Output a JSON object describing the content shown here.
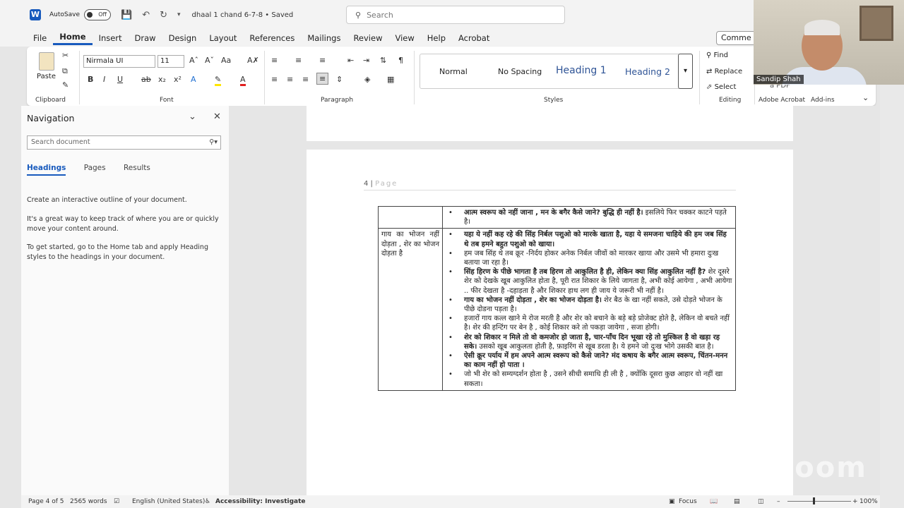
{
  "titlebar": {
    "autosave_label": "AutoSave",
    "autosave_state": "Off",
    "doc_name": "dhaal 1 chand 6-7-8 • Saved",
    "search_placeholder": "Search"
  },
  "menu": {
    "items": [
      "File",
      "Home",
      "Insert",
      "Draw",
      "Design",
      "Layout",
      "References",
      "Mailings",
      "Review",
      "View",
      "Help",
      "Acrobat"
    ],
    "comments": "Comme"
  },
  "ribbon": {
    "paste": "Paste",
    "font_name": "Nirmala UI",
    "font_size": "11",
    "groups": {
      "clipboard": "Clipboard",
      "font": "Font",
      "paragraph": "Paragraph",
      "styles": "Styles",
      "editing": "Editing",
      "adobe": "Adobe Acrobat",
      "addins": "Add-ins"
    },
    "styles": [
      "Normal",
      "No Spacing",
      "Heading 1",
      "Heading 2"
    ],
    "editing": {
      "find": "Find",
      "replace": "Replace",
      "select": "Select",
      "pdf": "a PDF"
    }
  },
  "navigation": {
    "title": "Navigation",
    "search_placeholder": "Search document",
    "tabs": [
      "Headings",
      "Pages",
      "Results"
    ],
    "p1": "Create an interactive outline of your document.",
    "p2": "It's a great way to keep track of where you are or quickly move your content around.",
    "p3": "To get started, go to the Home tab and apply Heading styles to the headings in your document."
  },
  "document": {
    "page_number": "4",
    "page_label": "Page",
    "row1": {
      "col1": "",
      "items": [
        {
          "bold": "आत्म स्वरूप को नहीं जाना , मन के बगैर कैसे जाने? बुद्धि ही नहीं है।",
          "normal": " इसलिये फिर चक्कर काटने पड़ते है।"
        }
      ]
    },
    "row2": {
      "col1": "गाय का भोजन नहीं दोड़ता , शेर का भोजन दोड़ता है",
      "items": [
        {
          "bold": "यहा ये नहीं कह रहे की सिंह निर्बल पशुओ को मारके खाता है, यहा ये समजना चाहिये की हम जब सिंह थे तब हमने बहुत पशुओ को खाया।",
          "normal": ""
        },
        {
          "bold": "",
          "normal": "हम जब सिंह थे तब क्रूर -निर्दय होकर अनेक निर्बल जीवों को मारकर खाया और उसमे भी हमारा दुःख बताया जा रहा है।"
        },
        {
          "bold": "सिंह हिरण के पीछे भागता है तब हिरण तो आकुलित है ही, लेकिन क्या सिंह आकुलित नहीं है?",
          "normal": " शेर दूसरे शेर को देखके खूब आकुलित होता है, पूरी रात शिकार के लिये जागता है, अभी कोई आयेगा , अभी आयेगा .. फीर देखता है -दहाड़ता है और शिकार हाथ लग ही जाय ये जरूरी भी नहीं है।"
        },
        {
          "bold": "गाय का भोजन नहीं दोड़ता , शेर का भोजन दोड़ता है।",
          "normal": " शेर बैठ के खा नहीं सकते, उसे दोड़ते भोजन के पीछे दोडना पड़ता है।"
        },
        {
          "bold": "",
          "normal": "हजारों गाय कत्ल खाने मे रोज मरती है और शेर को बचाने के बड़े बड़े प्रोजेक्ट होते है, लेकिन वो बचते नहीं है। शेर की हन्टिंग पर बेन है , कोई शिकार करे तो पकड़ा जायेगा , सजा होगी।"
        },
        {
          "bold": "शेर को शिकार न मिले तो वो कमजोर हो जाता है, चार-पाँच दिन भूखा रहे तो मुश्किल है वो खड़ा रह सके।",
          "normal": " उसको खूब आकुलता होती है, फ़ाइरिंग से खूब डरता है। ये हमने जो दुःख भोगे उसकी बात है।"
        },
        {
          "bold": "ऐसी क्रूर पर्याय में हम अपने आत्म स्वरूप को कैसे जाने? मंद कषाय के बगैर आत्म स्वरूप, चिंतन-मनन का काम नहीं हो पाता ।",
          "normal": ""
        },
        {
          "bold": "",
          "normal": "जो भी शेर को सम्यग्दर्शन होता है , उसने सीधी समाधि ही ली है , क्योंकि दूसरा कुछ आहार वो नहीं खा सकता।"
        }
      ]
    }
  },
  "status": {
    "page": "Page 4 of 5",
    "words": "2565 words",
    "language": "English (United States)",
    "accessibility": "Accessibility: Investigate",
    "focus": "Focus",
    "zoom": "100%"
  },
  "webcam": {
    "name": "Sandip Shah"
  },
  "watermark": "zoom"
}
